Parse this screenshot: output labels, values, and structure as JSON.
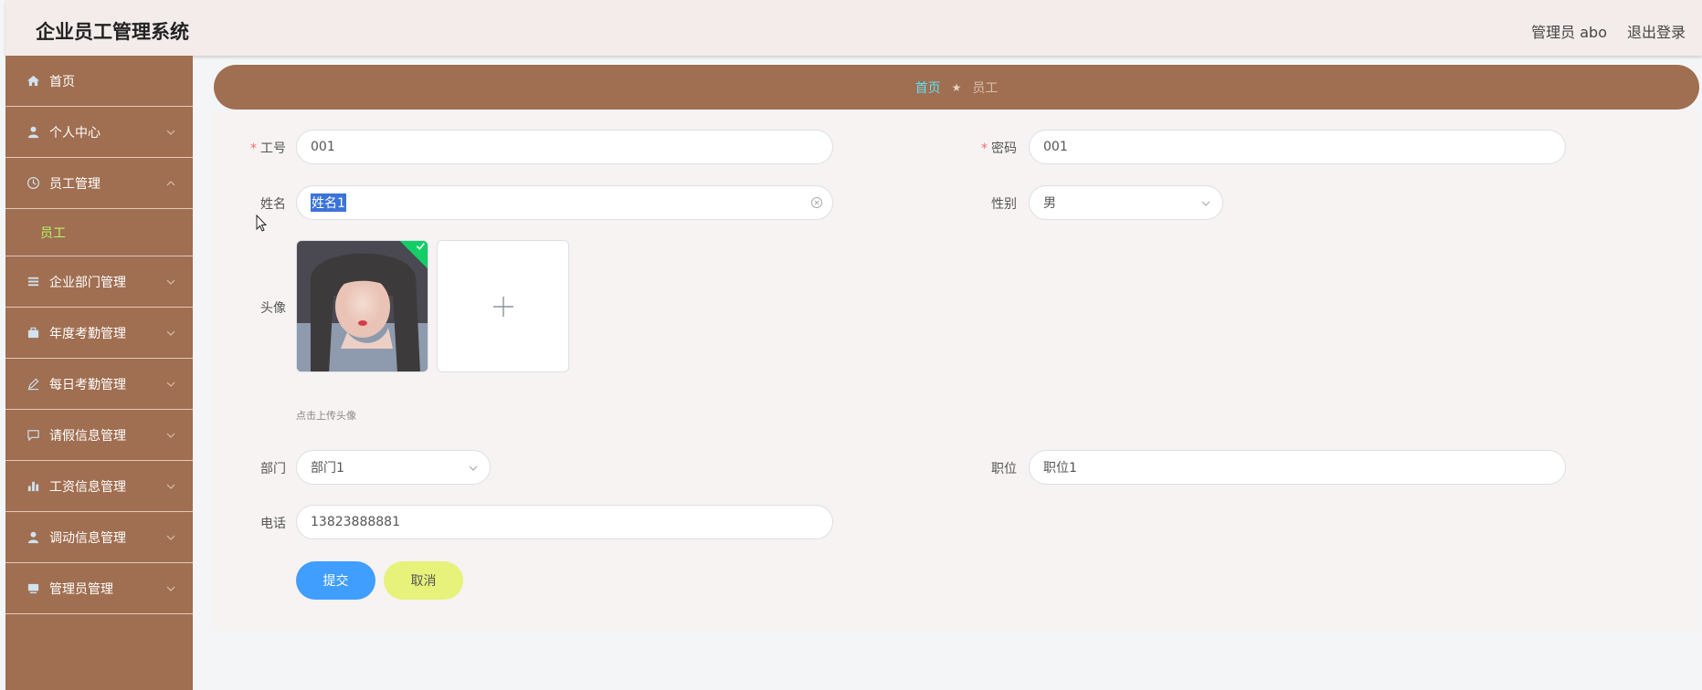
{
  "header": {
    "title": "企业员工管理系统",
    "user": "管理员 abo",
    "logout": "退出登录"
  },
  "sidebar": {
    "items": [
      {
        "label": "首页",
        "icon": "home-icon",
        "expandable": false
      },
      {
        "label": "个人中心",
        "icon": "user-icon",
        "expandable": true
      },
      {
        "label": "员工管理",
        "icon": "clock-icon",
        "expandable": true,
        "expanded": true
      },
      {
        "label": "企业部门管理",
        "icon": "list-icon",
        "expandable": true
      },
      {
        "label": "年度考勤管理",
        "icon": "briefcase-icon",
        "expandable": true
      },
      {
        "label": "每日考勤管理",
        "icon": "edit-icon",
        "expandable": true
      },
      {
        "label": "请假信息管理",
        "icon": "message-icon",
        "expandable": true
      },
      {
        "label": "工资信息管理",
        "icon": "bar-chart-icon",
        "expandable": true
      },
      {
        "label": "调动信息管理",
        "icon": "user-icon",
        "expandable": true
      },
      {
        "label": "管理员管理",
        "icon": "monitor-icon",
        "expandable": true
      }
    ],
    "submenu_active": "员工"
  },
  "breadcrumb": {
    "home": "首页",
    "current": "员工"
  },
  "form": {
    "employee_id": {
      "label": "工号",
      "value": "001",
      "required": true
    },
    "password": {
      "label": "密码",
      "value": "001",
      "required": true
    },
    "name": {
      "label": "姓名",
      "value": "姓名1"
    },
    "gender": {
      "label": "性别",
      "value": "男"
    },
    "avatar": {
      "label": "头像",
      "hint": "点击上传头像"
    },
    "department": {
      "label": "部门",
      "value": "部门1"
    },
    "position": {
      "label": "职位",
      "value": "职位1"
    },
    "phone": {
      "label": "电话",
      "value": "13823888881"
    }
  },
  "buttons": {
    "submit": "提交",
    "cancel": "取消"
  },
  "colors": {
    "sidebar": "#a06e50",
    "header": "#f3ecea",
    "submit": "#409eff",
    "cancel": "#e6f27a",
    "active_sub": "#b7f56b",
    "breadcrumb_home": "#5fe0f5"
  }
}
